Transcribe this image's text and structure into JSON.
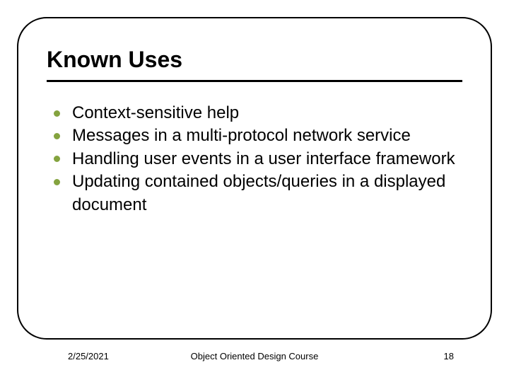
{
  "slide": {
    "title": "Known Uses",
    "bullets": [
      "Context-sensitive help",
      "Messages in a multi-protocol network service",
      "Handling user events in a user interface framework",
      "Updating contained objects/queries in a displayed document"
    ]
  },
  "footer": {
    "date": "2/25/2021",
    "course": "Object Oriented Design Course",
    "page": "18"
  }
}
